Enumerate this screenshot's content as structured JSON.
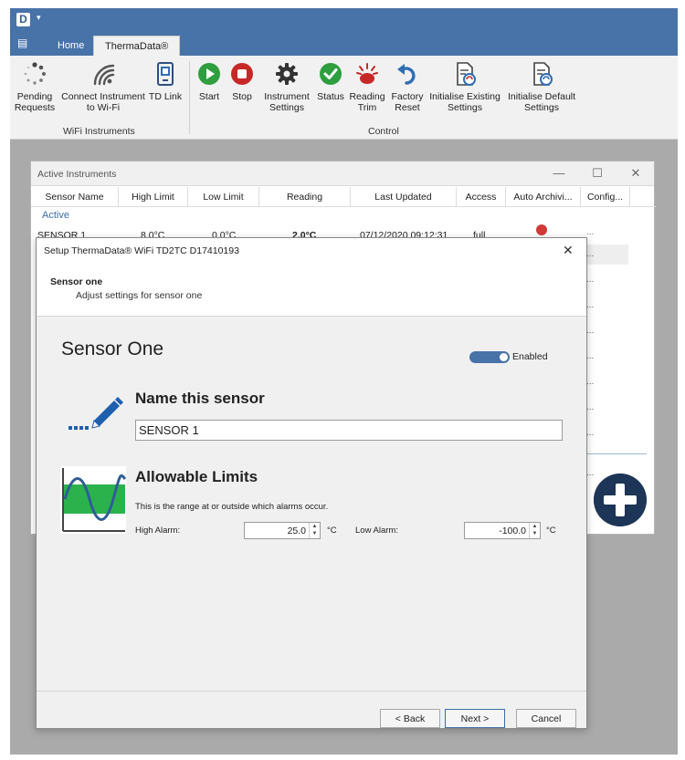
{
  "titlebar": {
    "logo": "D",
    "qat_arrow": "▾"
  },
  "tabs": {
    "file_glyph": "▤",
    "home": "Home",
    "thermadata": "ThermaData®"
  },
  "ribbon": {
    "wifi_group": {
      "label": "WiFi Instruments",
      "buttons": [
        {
          "label": "Pending Requests",
          "icon": "spinner-icon"
        },
        {
          "label": "Connect Instrument to Wi-Fi",
          "icon": "wifi-icon"
        },
        {
          "label": "TD Link",
          "icon": "td-link-icon"
        }
      ]
    },
    "control_group": {
      "label": "Control",
      "buttons": [
        {
          "label": "Start",
          "icon": "play-icon"
        },
        {
          "label": "Stop",
          "icon": "stop-icon"
        },
        {
          "label": "Instrument Settings",
          "icon": "gear-icon"
        },
        {
          "label": "Status",
          "icon": "check-icon"
        },
        {
          "label": "Reading Trim",
          "icon": "trim-icon"
        },
        {
          "label": "Factory Reset",
          "icon": "undo-icon"
        },
        {
          "label": "Initialise Existing Settings",
          "icon": "document-refresh-icon"
        },
        {
          "label": "Initialise Default Settings",
          "icon": "document-refresh-icon"
        }
      ]
    },
    "colors": {
      "play": "#2e9e3e",
      "stop": "#c62828",
      "status": "#2e9e3e",
      "undo": "#2f6db3"
    }
  },
  "active_instruments": {
    "title": "Active Instruments",
    "controls": {
      "minimize": "—",
      "maximize": "☐",
      "close": "✕"
    },
    "columns": [
      "Sensor Name",
      "High Limit",
      "Low Limit",
      "Reading",
      "Last Updated",
      "Access",
      "Auto Archivi...",
      "Config..."
    ],
    "group": "Active",
    "row": {
      "sensor_name": "SENSOR 1",
      "high_limit": "8.0°C",
      "low_limit": "0.0°C",
      "reading": "2.0°C",
      "last_updated": "07/12/2020 09:12:31",
      "access": "full"
    },
    "config_ellipsis": "..."
  },
  "dialog": {
    "title": "Setup ThermaData® WiFi TD2TC D17410193",
    "close": "✕",
    "header_title": "Sensor one",
    "header_subtitle": "Adjust settings for sensor one",
    "sensor_title": "Sensor One",
    "enabled_label": "Enabled",
    "enabled": true,
    "name_heading": "Name this sensor",
    "name_value": "SENSOR 1",
    "limits_heading": "Allowable Limits",
    "limits_description": "This is the range at or outside which alarms occur.",
    "high_alarm_label": "High Alarm:",
    "high_alarm_value": "25.0",
    "low_alarm_label": "Low Alarm:",
    "low_alarm_value": "-100.0",
    "unit": "°C",
    "back_button": "< Back",
    "next_button": "Next >",
    "cancel_button": "Cancel"
  }
}
